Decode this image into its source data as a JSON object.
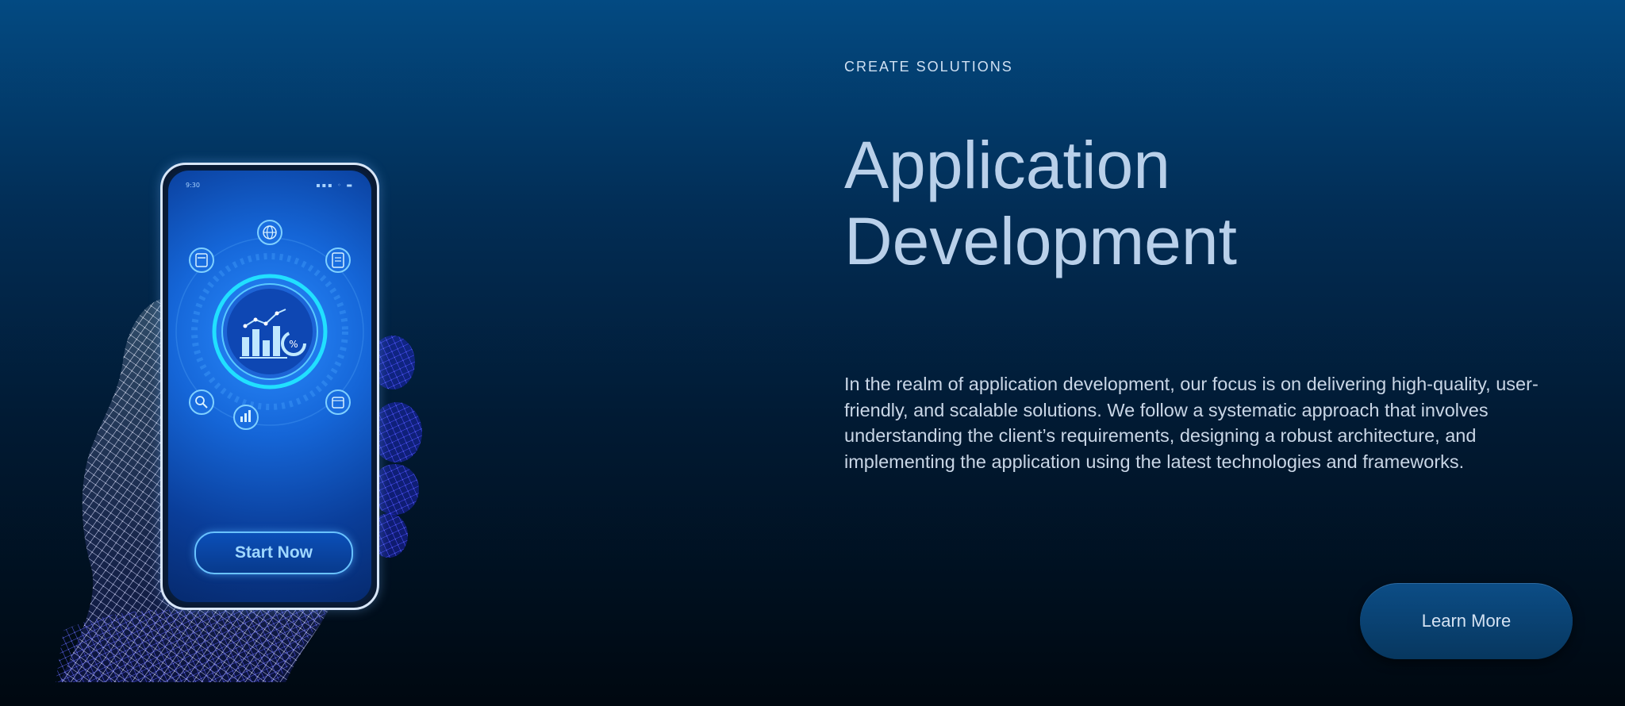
{
  "hero": {
    "eyebrow": "CREATE SOLUTIONS",
    "title_line1": "Application",
    "title_line2": "Development",
    "description": "In the realm of application development, our focus is on delivering high-quality, user-friendly, and scalable solutions. We follow a systematic approach that involves understanding the client’s requirements, designing a robust architecture, and implementing the application using the latest technologies and frameworks.",
    "cta_label": "Learn More"
  },
  "phone": {
    "status_time": "9:30",
    "status_icons": "▪▪▪ ◦ ▬",
    "start_label": "Start Now",
    "chart_badge": "%",
    "app_icons": [
      "calculator-icon",
      "globe-icon",
      "document-icon",
      "search-icon",
      "bar-chart-icon",
      "calendar-icon"
    ]
  },
  "colors": {
    "background_top": "#034a82",
    "background_bottom": "#000810",
    "title": "#b9d0ea",
    "accent_blue": "#1566d8",
    "button": "#0c4d86"
  }
}
